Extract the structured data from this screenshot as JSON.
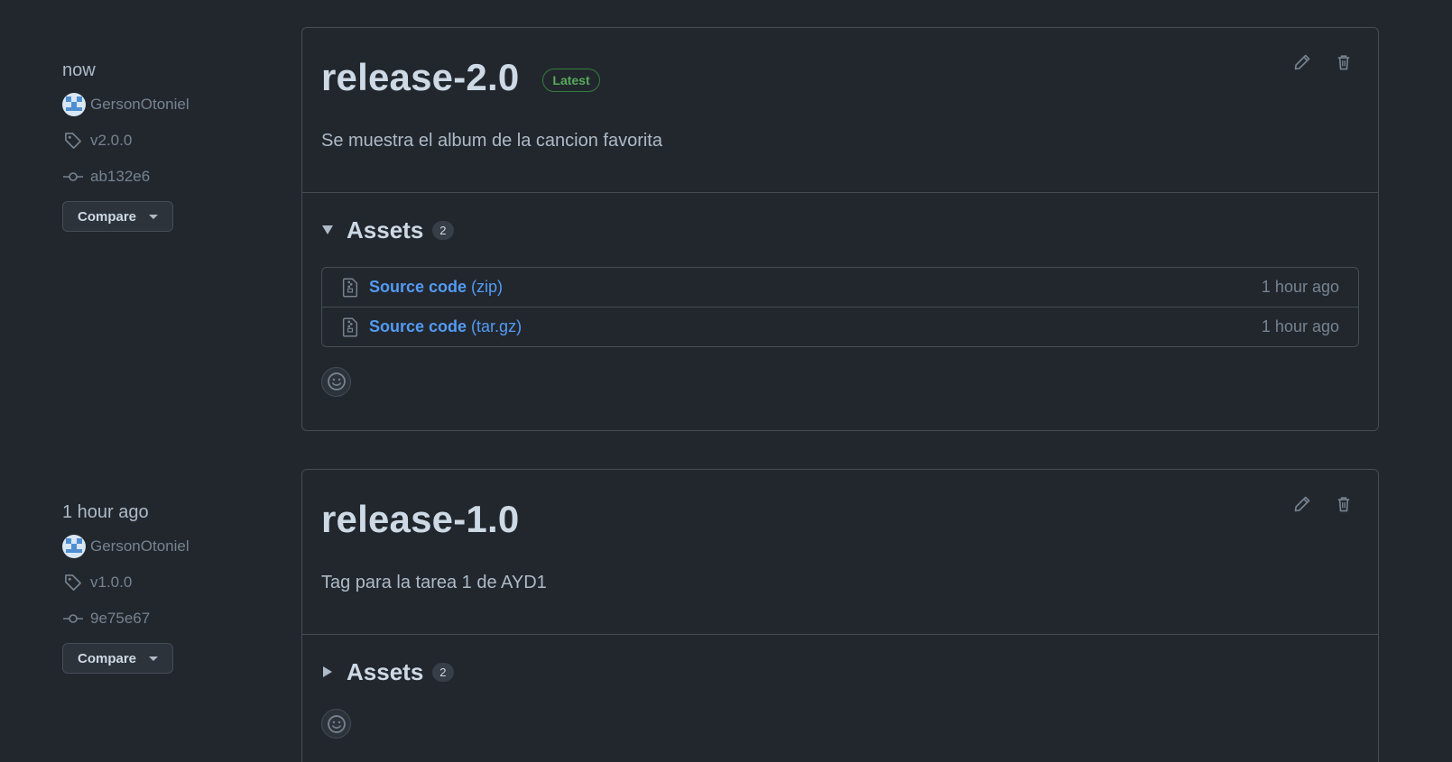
{
  "releases": [
    {
      "time": "now",
      "author": "GersonOtoniel",
      "tag": "v2.0.0",
      "commit": "ab132e6",
      "compare_label": "Compare",
      "title": "release-2.0",
      "badge": "Latest",
      "description": "Se muestra el album de la cancion favorita",
      "assets_label": "Assets",
      "assets_count": "2",
      "assets_expanded": true,
      "assets": [
        {
          "name": "Source code",
          "ext": "(zip)",
          "time": "1 hour ago"
        },
        {
          "name": "Source code",
          "ext": "(tar.gz)",
          "time": "1 hour ago"
        }
      ]
    },
    {
      "time": "1 hour ago",
      "author": "GersonOtoniel",
      "tag": "v1.0.0",
      "commit": "9e75e67",
      "compare_label": "Compare",
      "title": "release-1.0",
      "description": "Tag para la tarea 1 de AYD1",
      "assets_label": "Assets",
      "assets_count": "2",
      "assets_expanded": false
    }
  ],
  "icons": {
    "tag": "tag-icon",
    "commit": "git-commit-icon",
    "edit": "pencil-icon",
    "delete": "trash-icon",
    "zip": "file-zip-icon",
    "reaction": "smiley-icon"
  },
  "colors": {
    "background": "#22272e",
    "link": "#539bf5",
    "latest_badge": "#57ab5a",
    "border": "#444c56"
  }
}
